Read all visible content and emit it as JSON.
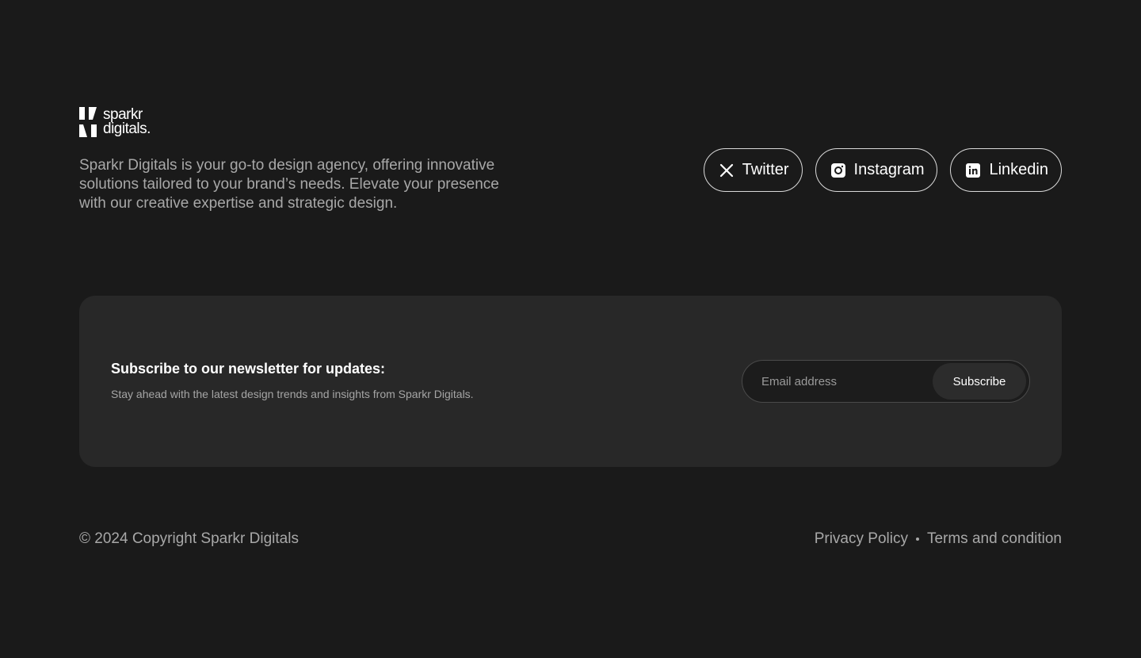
{
  "brand": {
    "line1": "sparkr",
    "line2": "digitals."
  },
  "tagline": "Sparkr Digitals is your go-to design agency, offering innovative solutions tailored to your brand’s needs. Elevate your presence with our creative expertise and strategic design.",
  "socials": [
    {
      "label": "Twitter",
      "icon": "x-twitter-icon"
    },
    {
      "label": "Instagram",
      "icon": "instagram-icon"
    },
    {
      "label": "Linkedin",
      "icon": "linkedin-icon"
    }
  ],
  "newsletter": {
    "title": "Subscribe to our newsletter for updates:",
    "subtitle": "Stay ahead with the latest design trends and insights from Sparkr Digitals.",
    "input_placeholder": "Email address",
    "button_label": "Subscribe"
  },
  "footer": {
    "copyright": "© 2024 Copyright Sparkr Digitals",
    "links": [
      "Privacy Policy",
      "Terms and condition"
    ]
  },
  "colors": {
    "background": "#1a1a1a",
    "card": "#282828",
    "muted_text": "#a8a8a8"
  }
}
